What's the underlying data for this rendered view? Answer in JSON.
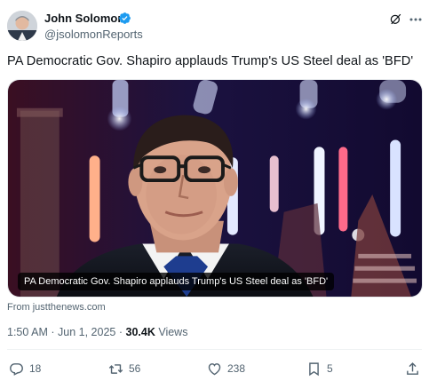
{
  "author": {
    "name": "John Solomon",
    "handle": "@jsolomonReports",
    "verified": true,
    "verified_color": "#1d9bf0"
  },
  "header_icons": [
    "grok-icon",
    "more-icon"
  ],
  "tweet": {
    "text": "PA Democratic Gov. Shapiro applauds Trump's US Steel deal as 'BFD'"
  },
  "media": {
    "caption": "PA Democratic Gov. Shapiro applauds Trump's US Steel deal as 'BFD'",
    "source": "From justthenews.com"
  },
  "meta": {
    "time": "1:50 AM",
    "separator": "·",
    "date": "Jun 1, 2025",
    "views_count": "30.4K",
    "views_label": "Views"
  },
  "actions": {
    "replies": "18",
    "reposts": "56",
    "likes": "238",
    "bookmarks": "5"
  },
  "colors": {
    "text_primary": "#0f1419",
    "text_secondary": "#536471",
    "divider": "#eff3f4"
  }
}
